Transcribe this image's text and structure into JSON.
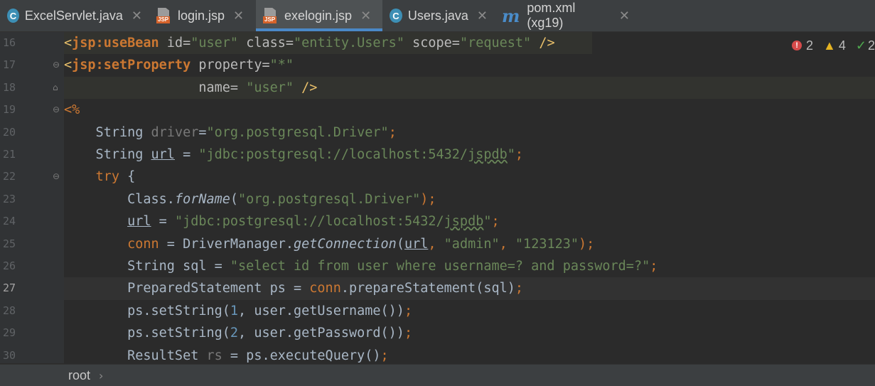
{
  "tabs": [
    {
      "label": "ExcelServlet.java",
      "icon": "java-class-icon"
    },
    {
      "label": "login.jsp",
      "icon": "jsp-file-icon"
    },
    {
      "label": "exelogin.jsp",
      "icon": "jsp-file-icon",
      "active": true
    },
    {
      "label": "Users.java",
      "icon": "java-class-icon"
    },
    {
      "label": "pom.xml (xg19)",
      "icon": "maven-icon"
    }
  ],
  "close_glyph": "✕",
  "inspections": {
    "errors": "2",
    "warnings": "4",
    "weak": "2"
  },
  "line_numbers": [
    "16",
    "17",
    "18",
    "19",
    "20",
    "21",
    "22",
    "23",
    "24",
    "25",
    "26",
    "27",
    "28",
    "29",
    "30"
  ],
  "current_line": "27",
  "code": {
    "l16": {
      "p1": "<",
      "p2": "jsp:useBean",
      "p3": " id=",
      "p4": "\"user\"",
      "p5": " class=",
      "p6": "\"entity.Users\"",
      "p7": " scope=",
      "p8": "\"request\"",
      "p9": " />"
    },
    "l17": {
      "p1": "<",
      "p2": "jsp:setProperty",
      "p3": " property=",
      "p4": "\"*\""
    },
    "l18": {
      "p1": "                 name= ",
      "p2": "\"user\"",
      "p3": " />"
    },
    "l19": {
      "p1": "<%"
    },
    "l20": {
      "p1": "    String ",
      "p2": "driver",
      "p3": "=",
      "p4": "\"org.postgresql.Driver\"",
      "p5": ";"
    },
    "l21": {
      "p1": "    String ",
      "p2": "url",
      "p3": " = ",
      "p4": "\"jdbc:postgresql://localhost:5432/",
      "p5": "jspdb",
      "p6": "\"",
      "p7": ";"
    },
    "l22": {
      "p1": "    ",
      "p2": "try",
      "p3": " {"
    },
    "l23": {
      "p1": "        Class.",
      "p2": "forName",
      "p3": "(",
      "p4": "\"org.postgresql.Driver\"",
      "p5": ");"
    },
    "l24": {
      "p1": "        ",
      "p2": "url",
      "p3": " = ",
      "p4": "\"jdbc:postgresql://localhost:5432/",
      "p5": "jspdb",
      "p6": "\"",
      "p7": ";"
    },
    "l25": {
      "p1": "        ",
      "p2": "conn",
      "p3": " = DriverManager.",
      "p4": "getConnection",
      "p5": "(",
      "p6": "url",
      "p7": ", ",
      "p8": "\"admin\"",
      "p9": ", ",
      "p10": "\"123123\"",
      "p11": ");"
    },
    "l26": {
      "p1": "        String sql = ",
      "p2": "\"select id from user where username=? and password=?\"",
      "p3": ";"
    },
    "l27": {
      "p1": "        PreparedStatement ps = ",
      "p2": "conn",
      "p3": ".prepareStatement(sql)",
      "p4": ";"
    },
    "l28": {
      "p1": "        ps.setString(",
      "p2": "1",
      "p3": ", user.getUsername())",
      "p4": ";"
    },
    "l29": {
      "p1": "        ps.setString(",
      "p2": "2",
      "p3": ", user.getPassword())",
      "p4": ";"
    },
    "l30": {
      "p1": "        ResultSet ",
      "p2": "rs",
      "p3": " = ps.executeQuery()",
      "p4": ";"
    }
  },
  "breadcrumb": {
    "item": "root",
    "sep": "›"
  }
}
